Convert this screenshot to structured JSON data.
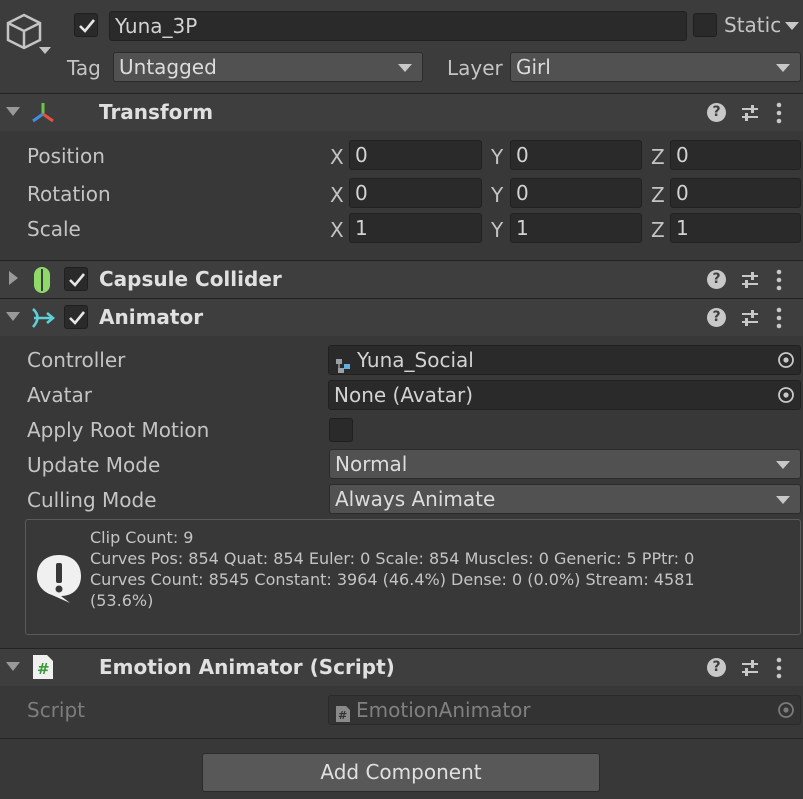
{
  "object": {
    "name": "Yuna_3P",
    "active": true,
    "static_label": "Static",
    "static_checked": false,
    "tag_label": "Tag",
    "tag_value": "Untagged",
    "layer_label": "Layer",
    "layer_value": "Girl"
  },
  "transform": {
    "title": "Transform",
    "position": {
      "label": "Position",
      "x": "0",
      "y": "0",
      "z": "0"
    },
    "rotation": {
      "label": "Rotation",
      "x": "0",
      "y": "0",
      "z": "0"
    },
    "scale": {
      "label": "Scale",
      "x": "1",
      "y": "1",
      "z": "1"
    },
    "axis_x": "X",
    "axis_y": "Y",
    "axis_z": "Z"
  },
  "capsule": {
    "title": "Capsule Collider",
    "enabled": true
  },
  "animator": {
    "title": "Animator",
    "enabled": true,
    "controller_label": "Controller",
    "controller_value": "Yuna_Social",
    "avatar_label": "Avatar",
    "avatar_value": "None (Avatar)",
    "root_motion_label": "Apply Root Motion",
    "root_motion_checked": false,
    "update_mode_label": "Update Mode",
    "update_mode_value": "Normal",
    "culling_mode_label": "Culling Mode",
    "culling_mode_value": "Always Animate",
    "info": {
      "line1": "Clip Count: 9",
      "line2": "Curves Pos: 854 Quat: 854 Euler: 0 Scale: 854 Muscles: 0 Generic: 5 PPtr: 0",
      "line3": "Curves Count: 8545 Constant: 3964 (46.4%) Dense: 0 (0.0%) Stream: 4581",
      "line4": "(53.6%)"
    }
  },
  "emotion": {
    "title": "Emotion Animator (Script)",
    "script_label": "Script",
    "script_value": "EmotionAnimator"
  },
  "add_component_label": "Add Component",
  "colors": {
    "background": "#383838",
    "header": "#3e3e3e",
    "field": "#2a2a2a",
    "dropdown": "#515151",
    "capsule_green": "#8fd96b"
  }
}
